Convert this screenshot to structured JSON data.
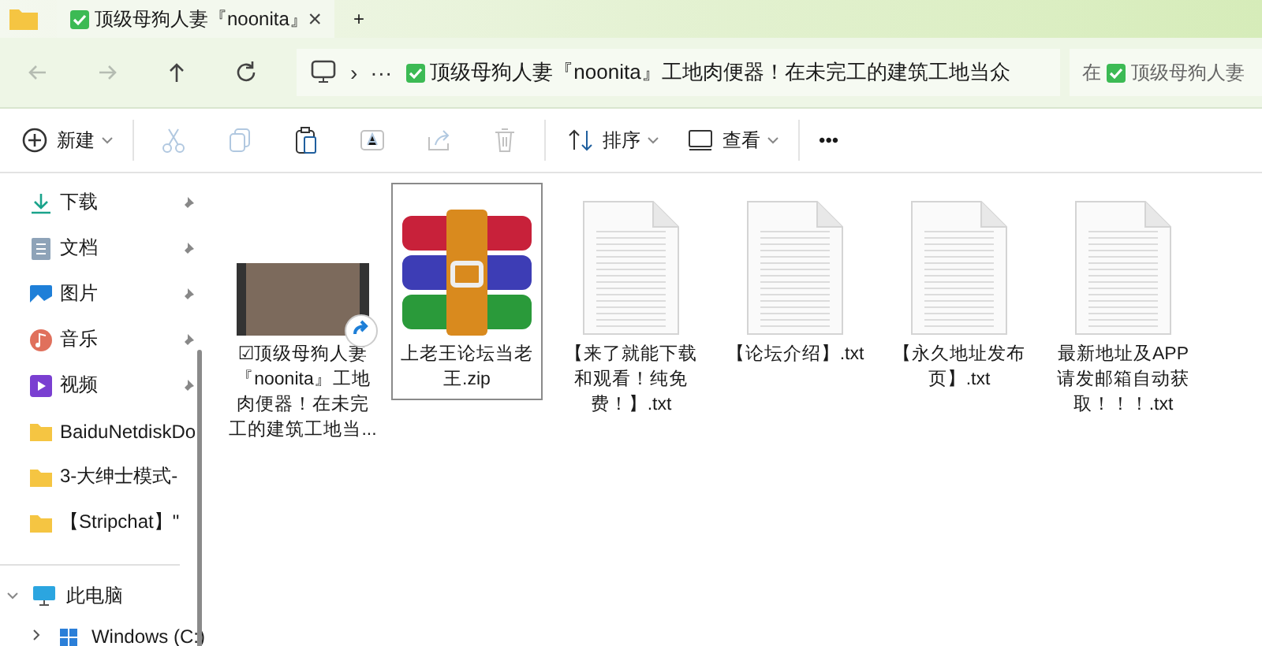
{
  "tab": {
    "title": "顶级母狗人妻『noonita』",
    "selected": true,
    "close": "×"
  },
  "new_tab": "+",
  "nav": [
    {
      "kind": "back",
      "disabled": true
    },
    {
      "kind": "forward",
      "disabled": true
    },
    {
      "kind": "up",
      "disabled": false
    },
    {
      "kind": "refresh",
      "disabled": false
    }
  ],
  "address": {
    "separator": "›",
    "more": "···",
    "path": "顶级母狗人妻『noonita』工地肉便器！在未完工的建筑工地当众"
  },
  "search": {
    "prefix": "在",
    "folder": "顶级母狗人妻"
  },
  "toolbar": [
    {
      "kind": "new",
      "label": "新建",
      "disabled": false
    },
    {
      "kind": "cut",
      "disabled": true
    },
    {
      "kind": "copy",
      "disabled": true
    },
    {
      "kind": "paste",
      "disabled": false
    },
    {
      "kind": "rename",
      "disabled": true
    },
    {
      "kind": "share",
      "disabled": true
    },
    {
      "kind": "delete",
      "disabled": true
    },
    {
      "kind": "sort",
      "label": "排序",
      "disabled": false
    },
    {
      "kind": "view",
      "label": "查看",
      "disabled": false
    },
    {
      "kind": "more",
      "label": "•••",
      "disabled": false
    }
  ],
  "sidebar": {
    "items": [
      {
        "kind": "download",
        "label": "下载",
        "pinned": true
      },
      {
        "kind": "documents",
        "label": "文档",
        "pinned": true
      },
      {
        "kind": "pictures",
        "label": "图片",
        "pinned": true
      },
      {
        "kind": "music",
        "label": "音乐",
        "pinned": true
      },
      {
        "kind": "videos",
        "label": "视频",
        "pinned": true
      },
      {
        "kind": "folder",
        "label": "BaiduNetdiskDo",
        "pinned": false
      },
      {
        "kind": "folder",
        "label": "3-大绅士模式-",
        "pinned": false
      },
      {
        "kind": "folder",
        "label": "【Stripchat】\"",
        "pinned": false
      }
    ],
    "tree": [
      {
        "kind": "pc",
        "label": "此电脑",
        "expanded": true,
        "children": [
          {
            "kind": "drive",
            "label": "Windows (C:)",
            "expanded": false
          }
        ]
      }
    ]
  },
  "files": [
    {
      "kind": "video",
      "name": "☑顶级母狗人妻『noonita』工地肉便器！在未完工的建筑工地当...",
      "selected": false
    },
    {
      "kind": "zip",
      "name": "上老王论坛当老王.zip",
      "selected": true
    },
    {
      "kind": "txt",
      "name": "【来了就能下载和观看！纯免费！】.txt",
      "selected": false
    },
    {
      "kind": "txt",
      "name": "【论坛介绍】.txt",
      "selected": false
    },
    {
      "kind": "txt",
      "name": "【永久地址发布页】.txt",
      "selected": false
    },
    {
      "kind": "txt",
      "name": "最新地址及APP请发邮箱自动获取！！！.txt",
      "selected": false
    }
  ]
}
